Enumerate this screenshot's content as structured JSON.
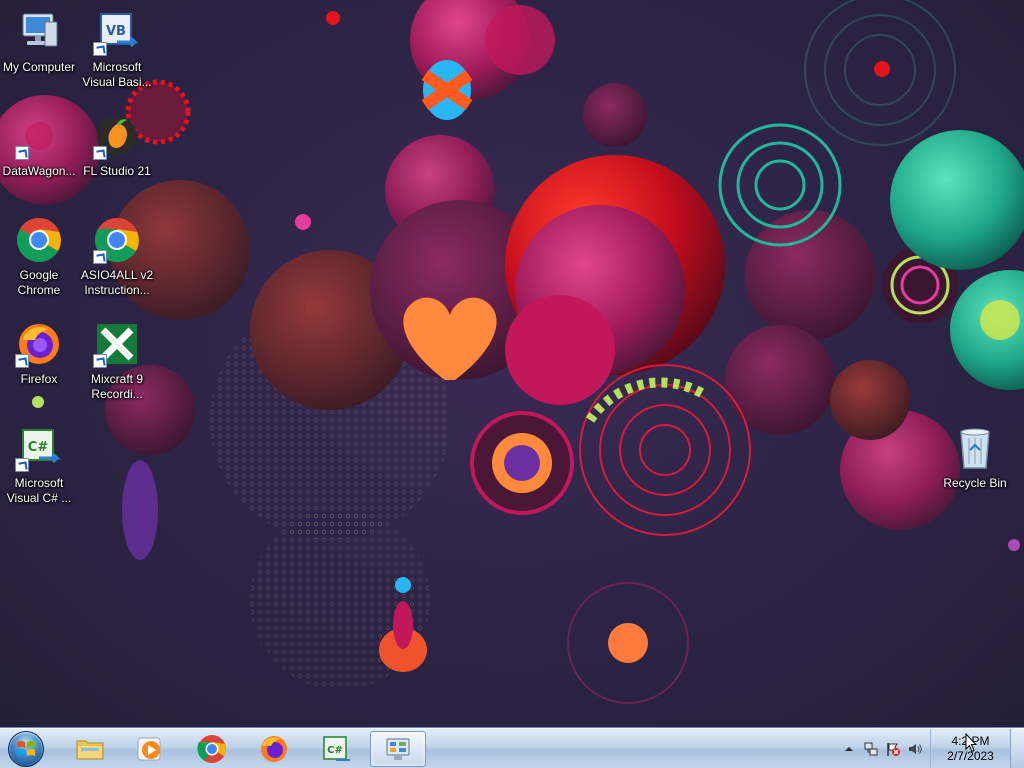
{
  "desktop": {
    "icons": [
      {
        "label": "My Computer",
        "icon": "computer-icon"
      },
      {
        "label": "Microsoft Visual Basi...",
        "icon": "vb-icon"
      },
      {
        "label": "DataWagon...",
        "icon": "datawagon-icon"
      },
      {
        "label": "FL Studio 21",
        "icon": "fl-studio-icon"
      },
      {
        "label": "Google Chrome",
        "icon": "chrome-icon"
      },
      {
        "label": "ASIO4ALL v2 Instruction...",
        "icon": "chrome-icon"
      },
      {
        "label": "Firefox",
        "icon": "firefox-icon"
      },
      {
        "label": "Mixcraft 9 Recordi...",
        "icon": "mixcraft-icon"
      },
      {
        "label": "Microsoft Visual C# ...",
        "icon": "csharp-icon"
      },
      {
        "label": "Recycle Bin",
        "icon": "recycle-bin-icon"
      }
    ]
  },
  "taskbar": {
    "pinned": [
      {
        "name": "Windows Explorer",
        "icon": "folder-icon"
      },
      {
        "name": "Windows Media Player",
        "icon": "media-player-icon"
      },
      {
        "name": "Google Chrome",
        "icon": "chrome-icon"
      },
      {
        "name": "Firefox",
        "icon": "firefox-icon"
      },
      {
        "name": "Microsoft Visual C#",
        "icon": "csharp-icon"
      },
      {
        "name": "Control Panel",
        "icon": "control-panel-icon",
        "active": true
      }
    ],
    "tray": {
      "icons": [
        "show-hidden-icons-arrow",
        "network-icon",
        "action-center-flag-icon",
        "volume-icon"
      ],
      "clock": {
        "time": "4:2 PM",
        "date": "2/7/2023"
      }
    }
  },
  "colors": {
    "taskbar_top": "#e2ecf7",
    "taskbar_bottom": "#a9c1de",
    "wallpaper_base": "#2c2444",
    "accent_magenta": "#c2185b",
    "accent_red": "#e3141c",
    "accent_teal": "#1fb89a"
  }
}
